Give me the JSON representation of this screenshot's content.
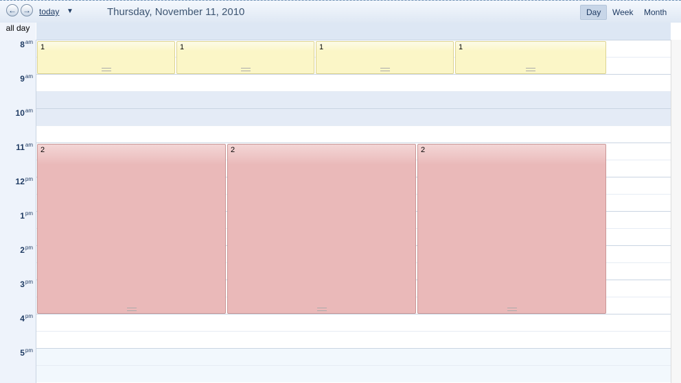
{
  "toolbar": {
    "prev_icon": "arrow-left-icon",
    "next_icon": "arrow-right-icon",
    "today_label": "today",
    "dropdown_icon": "caret-down-icon",
    "date_title": "Thursday, November 11, 2010",
    "views": [
      {
        "label": "Day",
        "active": true
      },
      {
        "label": "Week",
        "active": false
      },
      {
        "label": "Month",
        "active": false
      }
    ]
  },
  "allday_label": "all day",
  "hours": [
    {
      "num": "8",
      "ampm": "am"
    },
    {
      "num": "9",
      "ampm": "am"
    },
    {
      "num": "10",
      "ampm": "am"
    },
    {
      "num": "11",
      "ampm": "am"
    },
    {
      "num": "12",
      "ampm": "pm"
    },
    {
      "num": "1",
      "ampm": "pm"
    },
    {
      "num": "2",
      "ampm": "pm"
    },
    {
      "num": "3",
      "ampm": "pm"
    },
    {
      "num": "4",
      "ampm": "pm"
    },
    {
      "num": "5",
      "ampm": "pm"
    }
  ],
  "events": [
    {
      "title": "1",
      "color": "#fbf6c7"
    },
    {
      "title": "1",
      "color": "#fbf6c7"
    },
    {
      "title": "1",
      "color": "#fbf6c7"
    },
    {
      "title": "1",
      "color": "#fbf6c7"
    },
    {
      "title": "2",
      "color": "#eab9b9"
    },
    {
      "title": "2",
      "color": "#eab9b9"
    },
    {
      "title": "2",
      "color": "#eab9b9"
    }
  ],
  "colors": {
    "highlight_band": "#e4ebf6",
    "evening_band": "#f2f8fd"
  }
}
